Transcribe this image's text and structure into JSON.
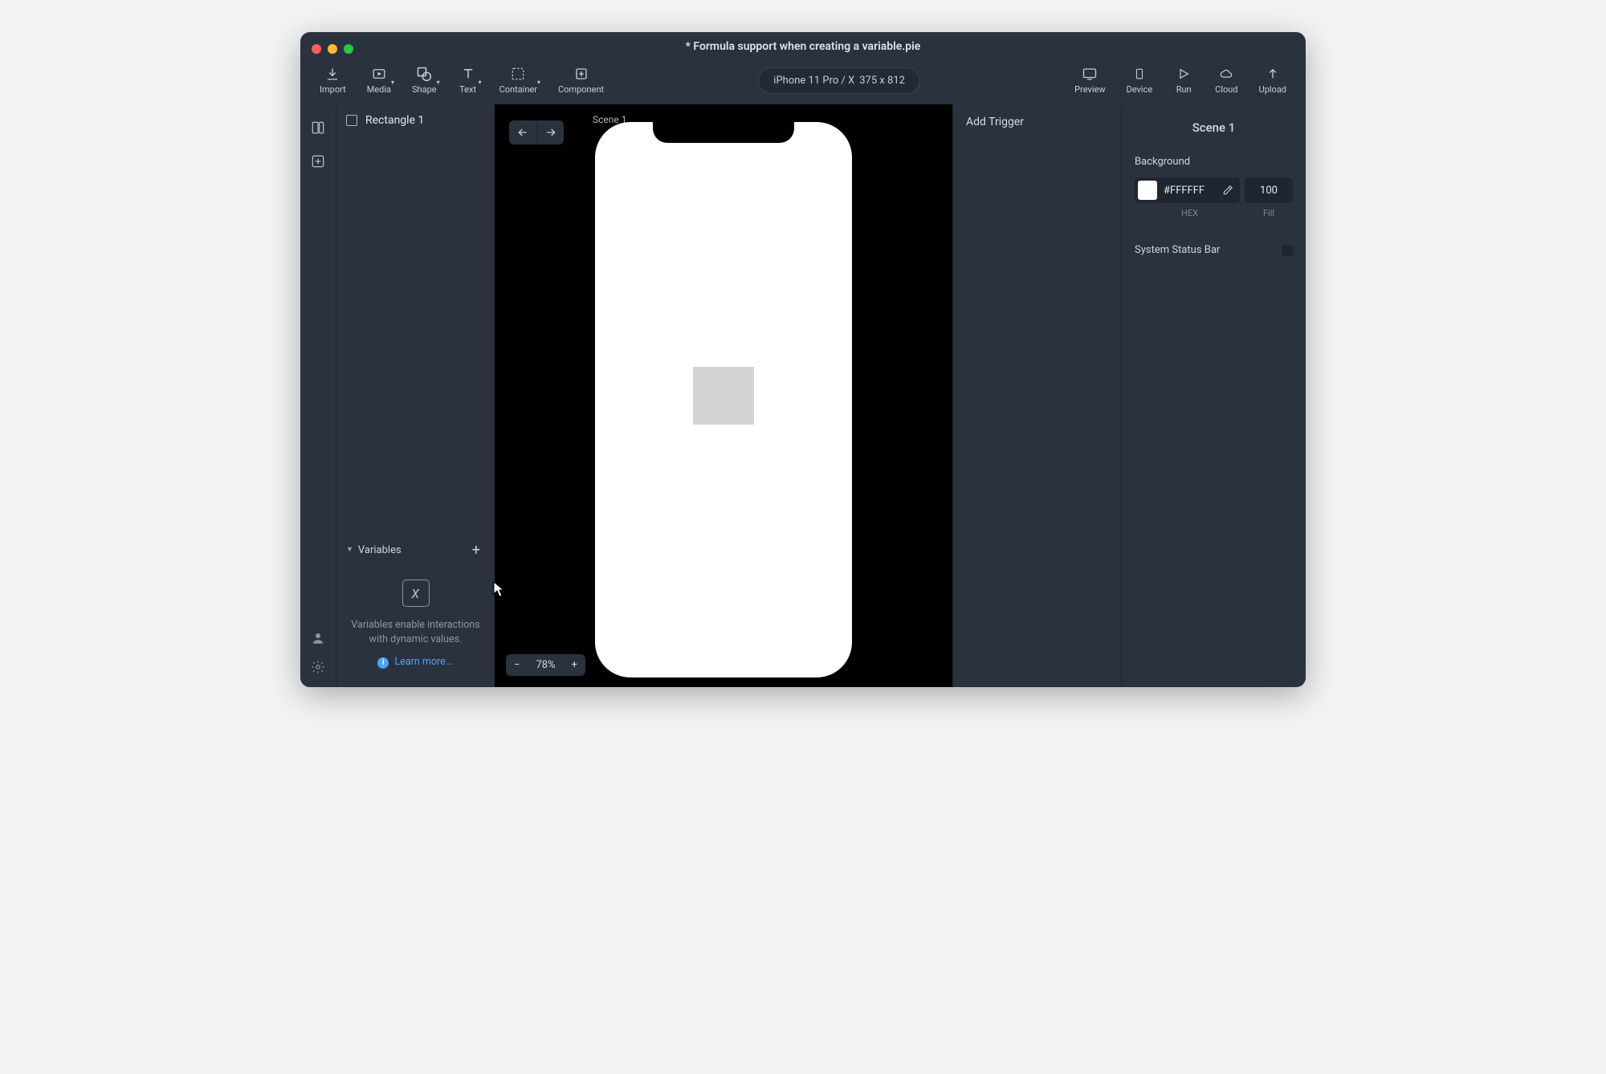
{
  "window": {
    "title": "* Formula support when creating a variable.pie"
  },
  "toolbar": {
    "import": "Import",
    "media": "Media",
    "shape": "Shape",
    "text": "Text",
    "container": "Container",
    "component": "Component",
    "preview": "Preview",
    "device": "Device",
    "run": "Run",
    "cloud": "Cloud",
    "upload": "Upload"
  },
  "device_pill": {
    "name": "iPhone 11 Pro / X",
    "size": "375 x 812"
  },
  "layers": {
    "item0": "Rectangle 1"
  },
  "variables": {
    "header": "Variables",
    "help_text": "Variables enable interactions with dynamic values.",
    "learn_more": "Learn more..."
  },
  "canvas": {
    "scene_label": "Scene 1",
    "zoom": "78%"
  },
  "trigger_panel": {
    "add": "Add Trigger"
  },
  "inspector": {
    "title": "Scene 1",
    "background_label": "Background",
    "bg_hex": "#FFFFFF",
    "bg_fill": "100",
    "hex_label": "HEX",
    "fill_label": "Fill",
    "system_status_bar": "System Status Bar"
  }
}
